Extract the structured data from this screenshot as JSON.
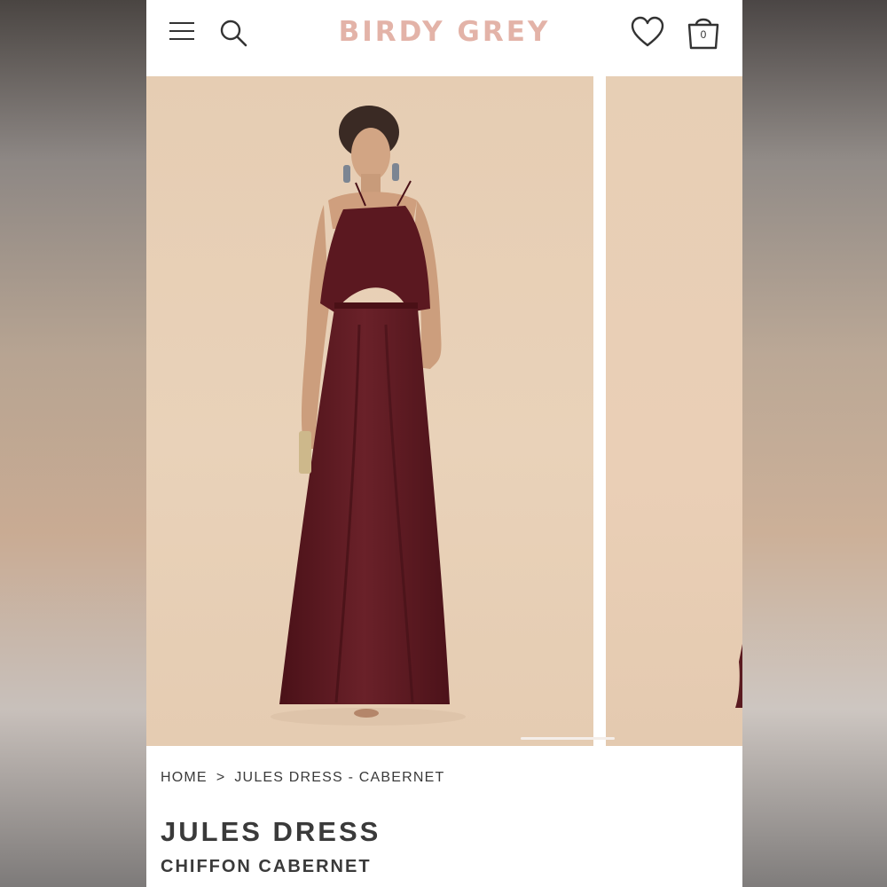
{
  "header": {
    "logo_text": "BIRDY GREY",
    "cart_count": "0",
    "logo_color": "#e3b3a8",
    "icons": [
      "menu-icon",
      "search-icon",
      "heart-icon",
      "bag-icon"
    ]
  },
  "gallery": {
    "images": [
      "product-photo-main",
      "product-photo-next"
    ],
    "background_color": "#e7cfb5",
    "dress_color": "#5a1a20"
  },
  "breadcrumb": {
    "home": "HOME",
    "separator": ">",
    "current": "JULES DRESS - CABERNET"
  },
  "product": {
    "title": "JULES DRESS",
    "subtitle": "CHIFFON CABERNET"
  }
}
